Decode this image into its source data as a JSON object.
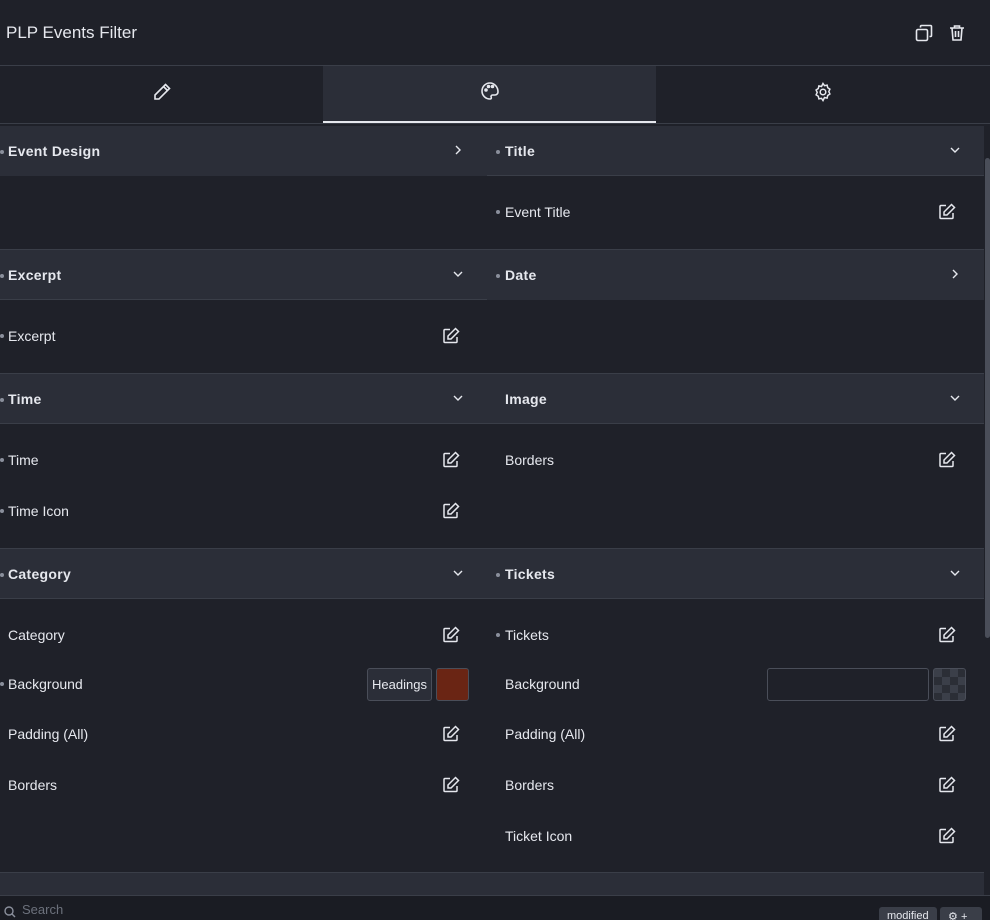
{
  "header": {
    "title": "PLP Events Filter"
  },
  "tabs": [
    {
      "icon": "pencil-icon",
      "active": false
    },
    {
      "icon": "palette-icon",
      "active": true
    },
    {
      "icon": "gear-icon",
      "active": false
    }
  ],
  "sections": {
    "event_design": {
      "label": "Event Design",
      "state": "collapsed"
    },
    "title": {
      "label": "Title",
      "state": "expanded",
      "rows": [
        "Event Title"
      ]
    },
    "excerpt": {
      "label": "Excerpt",
      "state": "expanded",
      "rows": [
        "Excerpt"
      ]
    },
    "date": {
      "label": "Date",
      "state": "collapsed"
    },
    "time": {
      "label": "Time",
      "state": "expanded",
      "rows": [
        "Time",
        "Time Icon"
      ]
    },
    "image": {
      "label": "Image",
      "state": "expanded",
      "rows": [
        "Borders"
      ]
    },
    "category": {
      "label": "Category",
      "state": "expanded",
      "rows": [
        "Category",
        "Background",
        "Padding (All)",
        "Borders"
      ],
      "background_button": "Headings",
      "background_color": "#6a2514"
    },
    "tickets": {
      "label": "Tickets",
      "state": "expanded",
      "rows": [
        "Tickets",
        "Background",
        "Padding (All)",
        "Borders",
        "Ticket Icon"
      ]
    }
  },
  "footer": {
    "search_placeholder": "Search",
    "badge_modified": "modified",
    "badge_add": "+"
  },
  "colors": {
    "background": "#1f2129",
    "section_header": "#2b2e38",
    "text": "#e6e8ee",
    "divider": "#3a3e48"
  }
}
